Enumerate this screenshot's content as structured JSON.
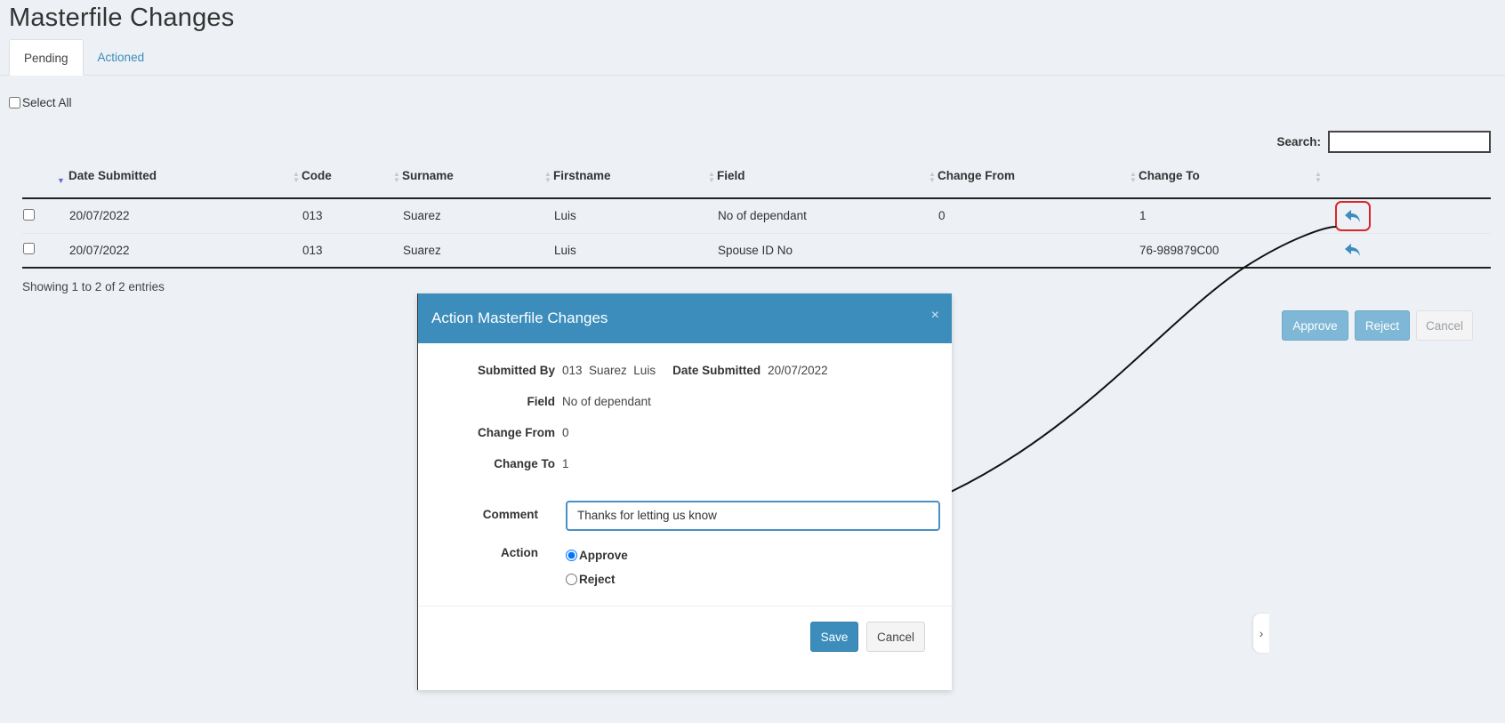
{
  "page": {
    "title": "Masterfile Changes"
  },
  "tabs": [
    {
      "label": "Pending",
      "active": true
    },
    {
      "label": "Actioned",
      "active": false
    }
  ],
  "select_all_label": "Select All",
  "search": {
    "label": "Search:",
    "value": ""
  },
  "table": {
    "columns": [
      "Date Submitted",
      "Code",
      "Surname",
      "Firstname",
      "Field",
      "Change From",
      "Change To"
    ],
    "rows": [
      {
        "date": "20/07/2022",
        "code": "013",
        "surname": "Suarez",
        "firstname": "Luis",
        "field": "No of dependant",
        "from": "0",
        "to": "1"
      },
      {
        "date": "20/07/2022",
        "code": "013",
        "surname": "Suarez",
        "firstname": "Luis",
        "field": "Spouse ID No",
        "from": "",
        "to": "76-989879C00"
      }
    ],
    "info": "Showing 1 to 2 of 2 entries"
  },
  "bulk_actions": {
    "approve": "Approve",
    "reject": "Reject",
    "cancel": "Cancel"
  },
  "modal": {
    "title": "Action Masterfile Changes",
    "close": "×",
    "submitted_by_label": "Submitted By",
    "submitted_by_value": "013  Suarez  Luis",
    "date_submitted_label": "Date Submitted",
    "date_submitted_value": "20/07/2022",
    "field_label": "Field",
    "field_value": "No of dependant",
    "change_from_label": "Change From",
    "change_from_value": "0",
    "change_to_label": "Change To",
    "change_to_value": "1",
    "comment_label": "Comment",
    "comment_value": "Thanks for letting us know",
    "action_label": "Action",
    "approve_option": "Approve",
    "reject_option": "Reject",
    "save": "Save",
    "cancel": "Cancel"
  },
  "colors": {
    "primary": "#3c8dbc",
    "highlight": "#d9262b"
  },
  "icons": {
    "row_action": "reply-icon",
    "side_toggle": "chevron-right-icon"
  }
}
